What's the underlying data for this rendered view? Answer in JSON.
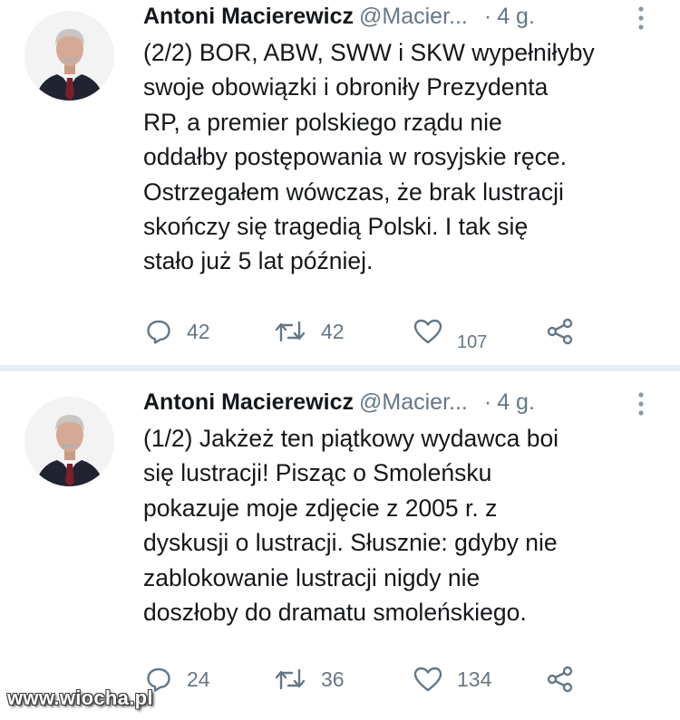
{
  "tweets": [
    {
      "author_name": "Antoni Macierewicz",
      "handle": "@Macier...",
      "separator": "·",
      "time": "4 g.",
      "text_lines": [
        "(2/2) BOR, ABW, SWW i SKW wypełniłyby",
        "swoje obowiązki i obroniły Prezydenta",
        "RP, a premier polskiego rządu nie",
        "oddałby postępowania w rosyjskie ręce.",
        "Ostrzegałem wówczas, że brak lustracji",
        "skończy się tragedią Polski. I tak się",
        "stało już 5 lat później."
      ],
      "reply_count": "42",
      "retweet_count": "42",
      "like_count": "107"
    },
    {
      "author_name": "Antoni Macierewicz",
      "handle": "@Macier...",
      "separator": "·",
      "time": "4 g.",
      "text_lines": [
        "(1/2) Jakżeż ten piątkowy wydawca boi",
        "się lustracji! Pisząc o Smoleńsku",
        "pokazuje moje zdjęcie z 2005 r. z",
        "dyskusji o lustracji. Słusznie: gdyby nie",
        "zablokowanie lustracji nigdy nie",
        "doszłoby do dramatu smoleńskiego."
      ],
      "reply_count": "24",
      "retweet_count": "36",
      "like_count": "134"
    }
  ],
  "watermark": "www.wiocha.pl",
  "icons": [
    "reply-icon",
    "retweet-icon",
    "like-icon",
    "share-icon",
    "more-options-icon"
  ],
  "colors": {
    "text": "#14171a",
    "secondary": "#657786",
    "divider": "#e9eef2"
  }
}
